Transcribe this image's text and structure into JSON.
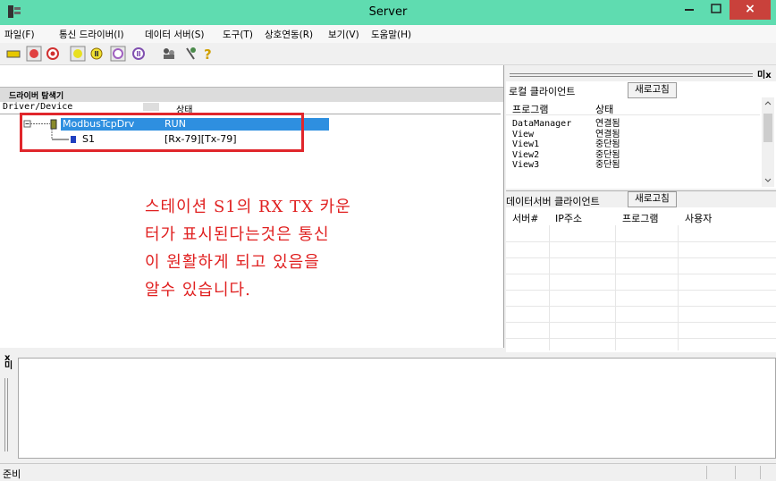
{
  "window": {
    "title": "Server",
    "close_glyph": "×"
  },
  "menu": [
    "파일(F)",
    "통신 드라이버(I)",
    "데이터 서버(S)",
    "도구(T)",
    "상호연동(R)",
    "보기(V)",
    "도움말(H)"
  ],
  "toolbar_icons": [
    "open-icon",
    "record-icon",
    "stop-record-icon",
    "play-icon",
    "pause-icon",
    "forward-icon",
    "pause-alt-icon",
    "users-icon",
    "settings-icon",
    "help-icon"
  ],
  "driver_explorer": {
    "title": "드라이버 탐색기",
    "columns": [
      "Driver/Device",
      "상태"
    ],
    "rows": [
      {
        "name": "ModbusTcpDrv",
        "status": "RUN"
      },
      {
        "name": "S1",
        "status": "[Rx-79][Tx-79]"
      }
    ]
  },
  "annotation": {
    "lines": [
      "스테이션 S1의 RX TX 카운",
      "터가 표시된다는것은 통신",
      "이 원활하게 되고 있음을",
      "알수 있습니다."
    ]
  },
  "local_client": {
    "title": "로컬 클라이언트",
    "refresh": "새로고침",
    "columns": [
      "프로그램",
      "상태"
    ],
    "rows": [
      {
        "program": "DataManager",
        "status": "연결됨"
      },
      {
        "program": "View",
        "status": "연결됨"
      },
      {
        "program": "View1",
        "status": "중단됨"
      },
      {
        "program": "View2",
        "status": "중단됨"
      },
      {
        "program": "View3",
        "status": "중단됨"
      }
    ]
  },
  "dataserver_client": {
    "title": "데이터서버 클라이언트",
    "refresh": "새로고침",
    "columns": [
      "서버#",
      "IP주소",
      "프로그램",
      "사용자"
    ]
  },
  "panel_close": "미x",
  "log_side": "x\n미",
  "status": "준비",
  "colors": {
    "title_bar": "#5fdcb0",
    "selection": "#2e8fe0",
    "annotation": "#e02020",
    "close": "#c9413b"
  }
}
